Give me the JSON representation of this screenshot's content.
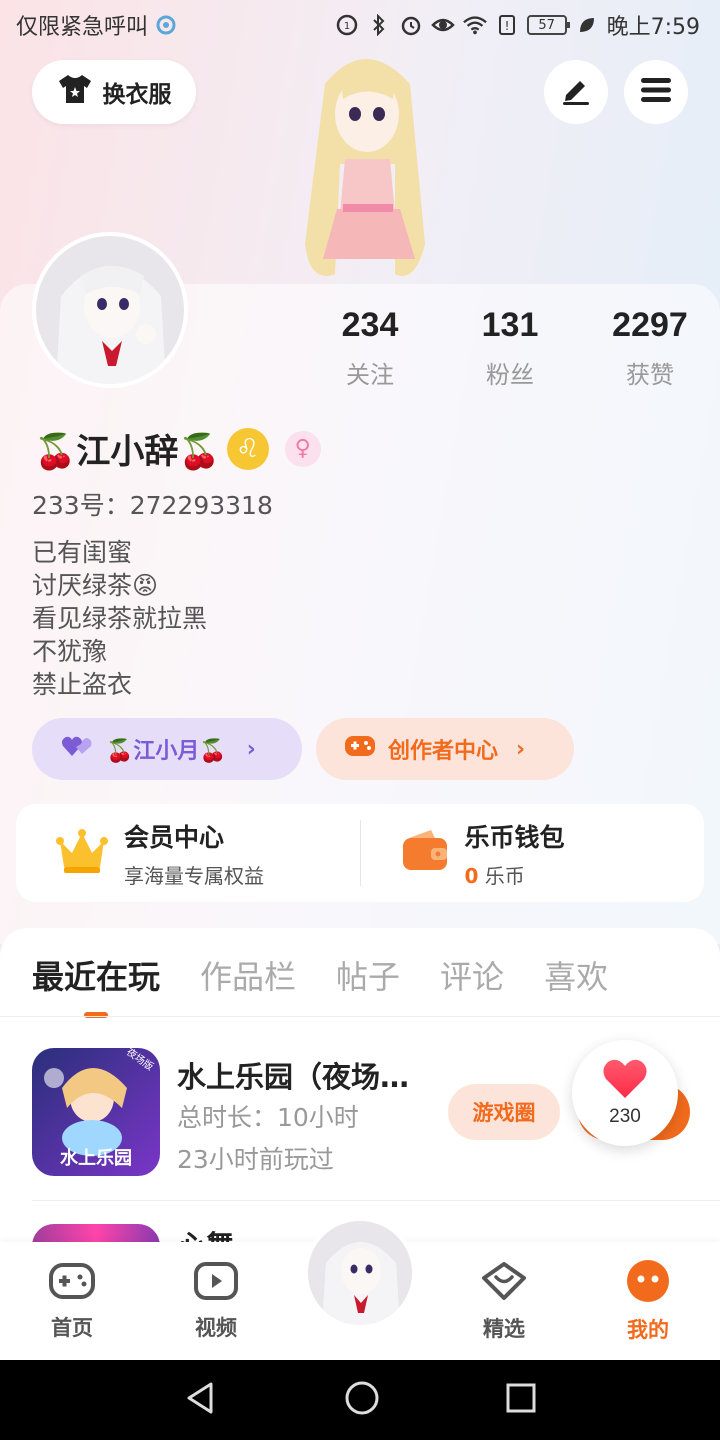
{
  "status_bar": {
    "carrier": "仅限紧急呼叫",
    "battery": "57",
    "time": "晚上7:59"
  },
  "header": {
    "outfit_label": "换衣服"
  },
  "profile": {
    "stats": [
      {
        "value": "234",
        "label": "关注"
      },
      {
        "value": "131",
        "label": "粉丝"
      },
      {
        "value": "2297",
        "label": "获赞"
      }
    ],
    "name": "🍒江小辞🍒",
    "uid": "233号：272293318",
    "bio": [
      "已有闺蜜",
      "讨厌绿茶😡",
      "看见绿茶就拉黑",
      "不犹豫",
      "禁止盗衣"
    ],
    "friend_label": "🍒江小月🍒",
    "creator_label": "创作者中心"
  },
  "benefits": {
    "vip_title": "会员中心",
    "vip_sub": "享海量专属权益",
    "wallet_title": "乐币钱包",
    "wallet_coins": "0",
    "wallet_unit": "乐币"
  },
  "tabs": [
    "最近在玩",
    "作品栏",
    "帖子",
    "评论",
    "喜欢"
  ],
  "games": [
    {
      "title": "水上乐园（夜场…",
      "duration": "总时长：10小时",
      "last_played": "23小时前玩过",
      "button": "游戏圈",
      "icon_text": "水上乐园",
      "icon_badge": "夜场版"
    }
  ],
  "peek_title": "心舞",
  "like_count": "230",
  "bottom_nav": {
    "home": "首页",
    "video": "视频",
    "featured": "精选",
    "mine": "我的"
  },
  "colors": {
    "accent": "#f26b1d",
    "friend_purple": "#7b5bd6"
  }
}
